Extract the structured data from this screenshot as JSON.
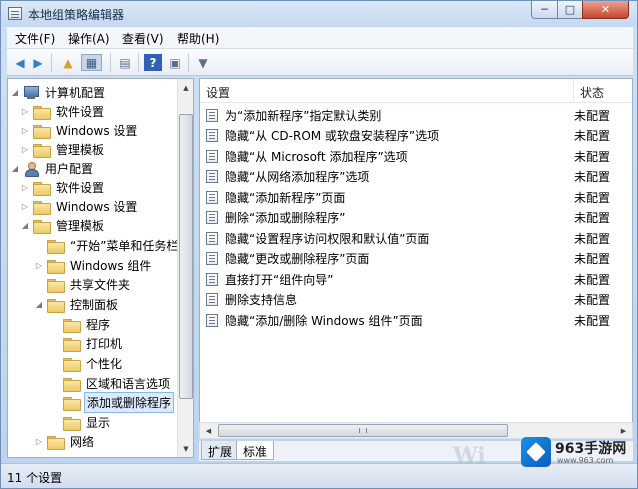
{
  "window": {
    "title": "本地组策略编辑器"
  },
  "menu": [
    "文件(F)",
    "操作(A)",
    "查看(V)",
    "帮助(H)"
  ],
  "tree": [
    {
      "label": "计算机配置",
      "level": 0,
      "icon": "computer-icon",
      "arrow": "expanded"
    },
    {
      "label": "软件设置",
      "level": 1,
      "icon": "folder-icon",
      "arrow": "collapsed"
    },
    {
      "label": "Windows 设置",
      "level": 1,
      "icon": "folder-icon",
      "arrow": "collapsed"
    },
    {
      "label": "管理模板",
      "level": 1,
      "icon": "folder-icon",
      "arrow": "collapsed"
    },
    {
      "label": "用户配置",
      "level": 0,
      "icon": "user-icon",
      "arrow": "expanded"
    },
    {
      "label": "软件设置",
      "level": 1,
      "icon": "folder-icon",
      "arrow": "collapsed"
    },
    {
      "label": "Windows 设置",
      "level": 1,
      "icon": "folder-icon",
      "arrow": "collapsed"
    },
    {
      "label": "管理模板",
      "level": 1,
      "icon": "folder-icon",
      "arrow": "expanded"
    },
    {
      "label": "“开始”菜单和任务栏",
      "level": 2,
      "icon": "folder-icon",
      "arrow": "none"
    },
    {
      "label": "Windows 组件",
      "level": 2,
      "icon": "folder-icon",
      "arrow": "collapsed"
    },
    {
      "label": "共享文件夹",
      "level": 2,
      "icon": "folder-icon",
      "arrow": "none"
    },
    {
      "label": "控制面板",
      "level": 2,
      "icon": "folder-icon",
      "arrow": "expanded"
    },
    {
      "label": "程序",
      "level": 3,
      "icon": "folder-icon",
      "arrow": "none"
    },
    {
      "label": "打印机",
      "level": 3,
      "icon": "folder-icon",
      "arrow": "none"
    },
    {
      "label": "个性化",
      "level": 3,
      "icon": "folder-icon",
      "arrow": "none"
    },
    {
      "label": "区域和语言选项",
      "level": 3,
      "icon": "folder-icon",
      "arrow": "none"
    },
    {
      "label": "添加或删除程序",
      "level": 3,
      "icon": "folder-icon",
      "arrow": "none",
      "selected": true
    },
    {
      "label": "显示",
      "level": 3,
      "icon": "folder-icon",
      "arrow": "none"
    },
    {
      "label": "网络",
      "level": 2,
      "icon": "folder-icon",
      "arrow": "collapsed"
    }
  ],
  "list": {
    "columns": {
      "setting": "设置",
      "state": "状态"
    },
    "rows": [
      {
        "name": "为“添加新程序”指定默认类别",
        "state": "未配置"
      },
      {
        "name": "隐藏“从 CD-ROM 或软盘安装程序”选项",
        "state": "未配置"
      },
      {
        "name": "隐藏“从 Microsoft 添加程序”选项",
        "state": "未配置"
      },
      {
        "name": "隐藏“从网络添加程序”选项",
        "state": "未配置"
      },
      {
        "name": "隐藏“添加新程序”页面",
        "state": "未配置"
      },
      {
        "name": "删除“添加或删除程序”",
        "state": "未配置"
      },
      {
        "name": "隐藏“设置程序访问权限和默认值”页面",
        "state": "未配置"
      },
      {
        "name": "隐藏“更改或删除程序”页面",
        "state": "未配置"
      },
      {
        "name": "直接打开“组件向导”",
        "state": "未配置"
      },
      {
        "name": "删除支持信息",
        "state": "未配置"
      },
      {
        "name": "隐藏“添加/删除 Windows 组件”页面",
        "state": "未配置"
      }
    ]
  },
  "tabs": [
    "扩展",
    "标准"
  ],
  "status": {
    "text": "11 个设置"
  },
  "watermark": {
    "brand": "963手游网",
    "url": "www.963.com",
    "ghost": "Wi"
  }
}
